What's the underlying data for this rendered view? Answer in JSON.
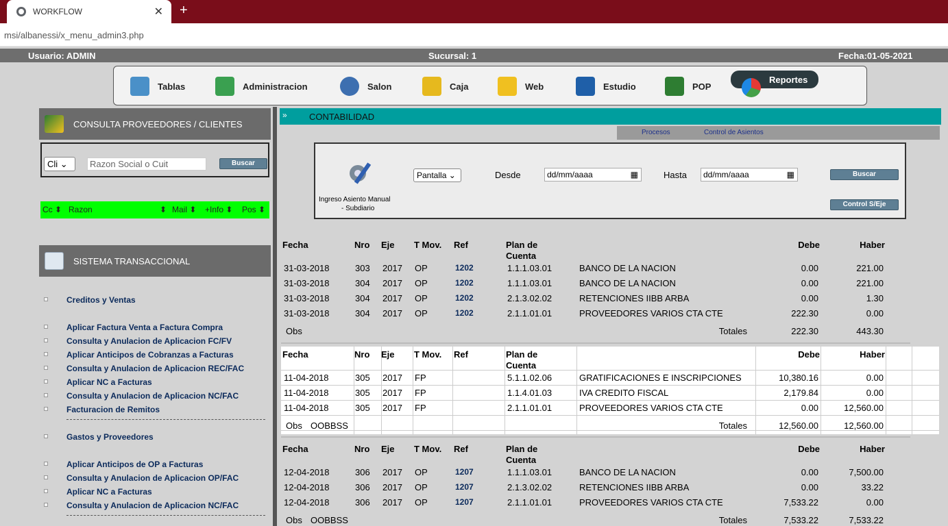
{
  "browser": {
    "tab_title": "WORKFLOW",
    "close_glyph": "✕",
    "newtab_glyph": "+",
    "url": "msi/albanessi/x_menu_admin3.php"
  },
  "infobar": {
    "usuario": "Usuario: ADMIN",
    "sucursal": "Sucursal: 1",
    "fecha": "Fecha:01-05-2021"
  },
  "nav": {
    "items": [
      {
        "label": "Tablas",
        "icon": "tables-icon",
        "color": "#4a90c8"
      },
      {
        "label": "Administracion",
        "icon": "admin-check-icon",
        "color": "#3aa050"
      },
      {
        "label": "Salon",
        "icon": "globe-icon",
        "color": "#3d6fb0"
      },
      {
        "label": "Caja",
        "icon": "cash-icon",
        "color": "#e6b91e"
      },
      {
        "label": "Web",
        "icon": "web-key-icon",
        "color": "#f0c020"
      },
      {
        "label": "Estudio",
        "icon": "book-icon",
        "color": "#1f5fa8"
      },
      {
        "label": "POP",
        "icon": "people-icon",
        "color": "#2e7d32"
      },
      {
        "label": "Reportes",
        "icon": "pie-chart-icon",
        "color": "#e53935"
      }
    ]
  },
  "sidebar": {
    "consulta_title": "CONSULTA PROVEEDORES / CLIENTES",
    "search": {
      "select_value": "Cli",
      "placeholder": "Razon Social o Cuit",
      "button": "Buscar"
    },
    "green_columns": [
      "Cc ⬍",
      "Razon",
      "⬍",
      "Mail ⬍",
      "+Info ⬍",
      "Pos ⬍"
    ],
    "sistema_title": "SISTEMA TRANSACCIONAL",
    "links": [
      "Creditos y Ventas",
      "Aplicar Factura Venta a Factura Compra",
      "Consulta y Anulacion de Aplicacion FC/FV",
      "Aplicar Anticipos de Cobranzas a Facturas",
      "Consulta y Anulacion de Aplicacion REC/FAC",
      "Aplicar NC a Facturas",
      "Consulta y Anulacion de Aplicacion NC/FAC",
      "Facturacion de Remitos",
      "Gastos y Proveedores",
      "Aplicar Anticipos de OP a Facturas",
      "Consulta y Anulacion de Aplicacion OP/FAC",
      "Aplicar NC a Facturas",
      "Consulta y Anulacion de Aplicacion NC/FAC"
    ]
  },
  "content": {
    "title": "CONTABILIDAD",
    "chevron": "»",
    "subtabs": [
      "Procesos",
      "Control de Asientos"
    ],
    "filter": {
      "icon_label_1": "Ingreso Asiento Manual",
      "icon_label_2": "- Subdiario",
      "output_select": "Pantalla",
      "desde_label": "Desde",
      "hasta_label": "Hasta",
      "date_placeholder": "dd/mm/aaaa",
      "buscar": "Buscar",
      "control": "Control S/Eje"
    },
    "headers": {
      "fecha": "Fecha",
      "nro": "Nro",
      "eje": "Eje",
      "tmov": "T Mov.",
      "ref": "Ref",
      "plan1": "Plan de",
      "plan2": "Cuenta",
      "debe": "Debe",
      "haber": "Haber"
    },
    "obs_label": "Obs",
    "totales_label": "Totales",
    "entries": [
      {
        "obs": "",
        "rows": [
          {
            "fecha": "31-03-2018",
            "nro": "303",
            "eje": "2017",
            "tmov": "OP",
            "ref": "1202",
            "cuenta": "1.1.1.03.01",
            "desc": "BANCO DE LA NACION",
            "debe": "0.00",
            "haber": "221.00"
          },
          {
            "fecha": "31-03-2018",
            "nro": "304",
            "eje": "2017",
            "tmov": "OP",
            "ref": "1202",
            "cuenta": "1.1.1.03.01",
            "desc": "BANCO DE LA NACION",
            "debe": "0.00",
            "haber": "221.00"
          },
          {
            "fecha": "31-03-2018",
            "nro": "304",
            "eje": "2017",
            "tmov": "OP",
            "ref": "1202",
            "cuenta": "2.1.3.02.02",
            "desc": "RETENCIONES IIBB ARBA",
            "debe": "0.00",
            "haber": "1.30"
          },
          {
            "fecha": "31-03-2018",
            "nro": "304",
            "eje": "2017",
            "tmov": "OP",
            "ref": "1202",
            "cuenta": "2.1.1.01.01",
            "desc": "PROVEEDORES VARIOS CTA CTE",
            "debe": "222.30",
            "haber": "0.00"
          }
        ],
        "total_debe": "222.30",
        "total_haber": "443.30"
      },
      {
        "obs": "OOBBSS",
        "rows": [
          {
            "fecha": "11-04-2018",
            "nro": "305",
            "eje": "2017",
            "tmov": "FP",
            "ref": "",
            "cuenta": "5.1.1.02.06",
            "desc": "GRATIFICACIONES E INSCRIPCIONES",
            "debe": "10,380.16",
            "haber": "0.00"
          },
          {
            "fecha": "11-04-2018",
            "nro": "305",
            "eje": "2017",
            "tmov": "FP",
            "ref": "",
            "cuenta": "1.1.4.01.03",
            "desc": "IVA CREDITO FISCAL",
            "debe": "2,179.84",
            "haber": "0.00"
          },
          {
            "fecha": "11-04-2018",
            "nro": "305",
            "eje": "2017",
            "tmov": "FP",
            "ref": "",
            "cuenta": "2.1.1.01.01",
            "desc": "PROVEEDORES VARIOS CTA CTE",
            "debe": "0.00",
            "haber": "12,560.00"
          }
        ],
        "total_debe": "12,560.00",
        "total_haber": "12,560.00"
      },
      {
        "obs": "OOBBSS",
        "rows": [
          {
            "fecha": "12-04-2018",
            "nro": "306",
            "eje": "2017",
            "tmov": "OP",
            "ref": "1207",
            "cuenta": "1.1.1.03.01",
            "desc": "BANCO DE LA NACION",
            "debe": "0.00",
            "haber": "7,500.00"
          },
          {
            "fecha": "12-04-2018",
            "nro": "306",
            "eje": "2017",
            "tmov": "OP",
            "ref": "1207",
            "cuenta": "2.1.3.02.02",
            "desc": "RETENCIONES IIBB ARBA",
            "debe": "0.00",
            "haber": "33.22"
          },
          {
            "fecha": "12-04-2018",
            "nro": "306",
            "eje": "2017",
            "tmov": "OP",
            "ref": "1207",
            "cuenta": "2.1.1.01.01",
            "desc": "PROVEEDORES VARIOS CTA CTE",
            "debe": "7,533.22",
            "haber": "0.00"
          }
        ],
        "total_debe": "7,533.22",
        "total_haber": "7,533.22"
      }
    ]
  }
}
